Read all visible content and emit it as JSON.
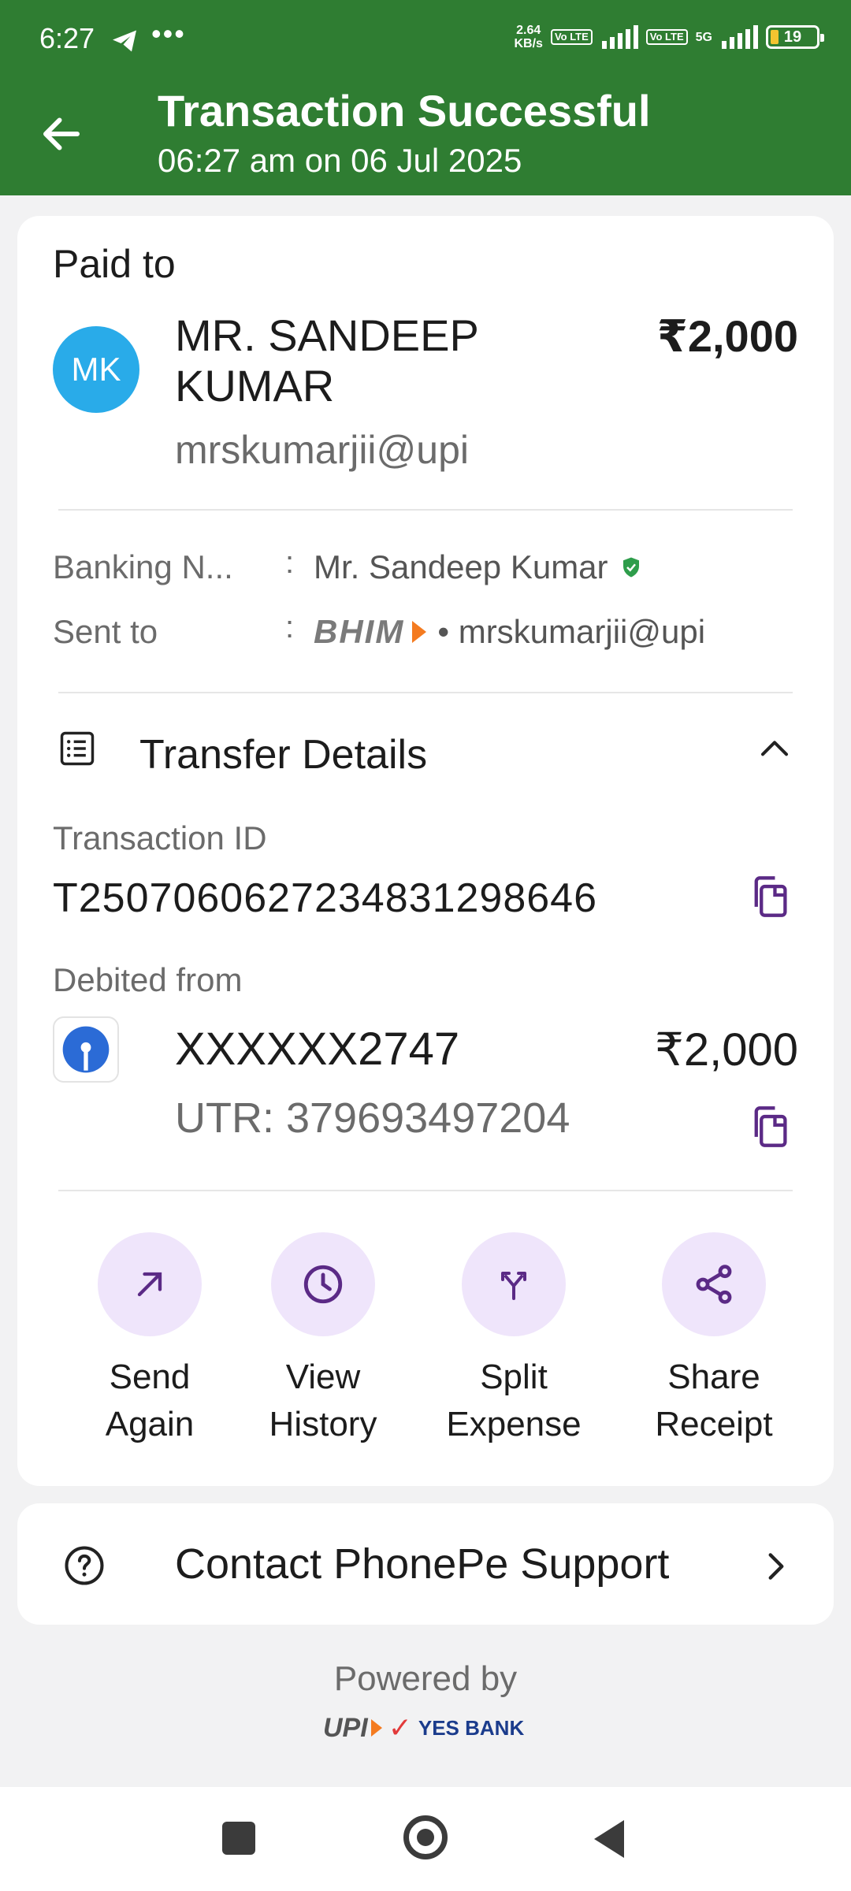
{
  "status_bar": {
    "time": "6:27",
    "more": "•••",
    "net_speed_value": "2.64",
    "net_speed_unit": "KB/s",
    "volte_label": "Vo LTE",
    "network_label": "5G",
    "battery": "19"
  },
  "header": {
    "title": "Transaction Successful",
    "subtitle": "06:27 am on 06 Jul 2025",
    "background_color": "#2f7d32"
  },
  "paid": {
    "label": "Paid to",
    "avatar_initials": "MK",
    "avatar_color": "#29abe9",
    "payee_name": "MR. SANDEEP KUMAR",
    "payee_upi": "mrskumarjii@upi",
    "amount": "₹2,000"
  },
  "details": {
    "banking_name_label": "Banking N...",
    "banking_name_value": "Mr. Sandeep  Kumar",
    "sent_to_label": "Sent to",
    "sent_to_app_logo": "BHIM",
    "sent_to_value": "• mrskumarjii@upi",
    "colon": ":"
  },
  "transfer": {
    "section_title": "Transfer Details",
    "transaction_id_label": "Transaction ID",
    "transaction_id": "T2507060627234831298646",
    "debited_from_label": "Debited from",
    "account_number": "XXXXXX2747",
    "debit_amount": "₹2,000",
    "utr": "UTR: 379693497204"
  },
  "actions": [
    {
      "label": "Send\nAgain",
      "icon": "send-arrow-icon"
    },
    {
      "label": "View\nHistory",
      "icon": "clock-icon"
    },
    {
      "label": "Split\nExpense",
      "icon": "split-icon"
    },
    {
      "label": "Share\nReceipt",
      "icon": "share-icon"
    }
  ],
  "support": {
    "label": "Contact PhonePe Support"
  },
  "footer": {
    "powered_by": "Powered by",
    "upi_logo": "UPI",
    "bank_name": "YES BANK"
  },
  "colors": {
    "accent_purple": "#5b2a86",
    "action_circle": "#efe5fb",
    "verified_green": "#2e9d4b"
  }
}
